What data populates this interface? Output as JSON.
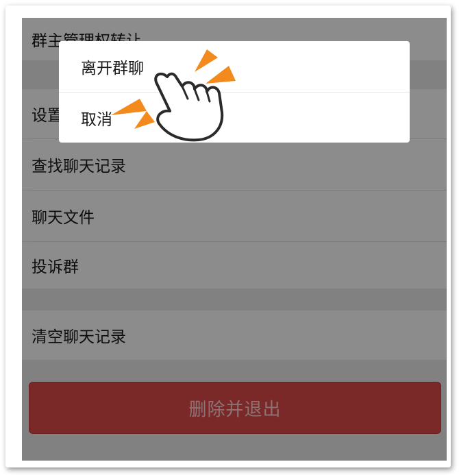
{
  "settings": {
    "items": [
      {
        "label": "群主管理权转让"
      },
      {
        "label": "设置当前聊天背景"
      },
      {
        "label": "查找聊天记录"
      },
      {
        "label": "聊天文件"
      },
      {
        "label": "投诉群"
      },
      {
        "label": "清空聊天记录"
      }
    ],
    "delete_button_label": "删除并退出"
  },
  "dialog": {
    "leave_label": "离开群聊",
    "cancel_label": "取消"
  },
  "colors": {
    "danger": "#e04a4a",
    "accent_arrow": "#f28a1e",
    "overlay": "rgba(0,0,0,0.45)"
  },
  "icons": [
    "hand-pointer-icon",
    "click-burst-icon"
  ]
}
